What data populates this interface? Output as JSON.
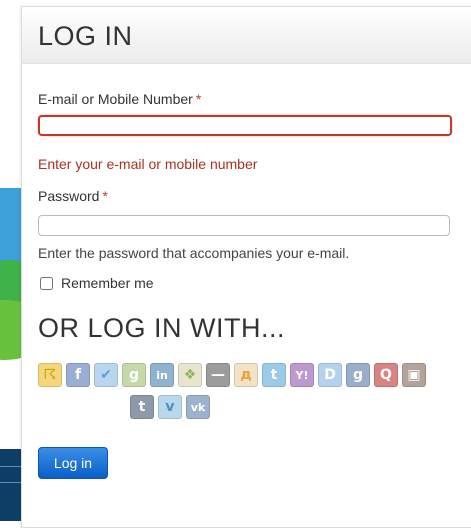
{
  "panel": {
    "title": "LOG IN"
  },
  "email": {
    "label": "E-mail or Mobile Number",
    "required_mark": "*",
    "value": "",
    "error": "Enter your e-mail or mobile number"
  },
  "password": {
    "label": "Password",
    "required_mark": "*",
    "value": "",
    "help": "Enter the password that accompanies your e-mail."
  },
  "remember": {
    "label": "Remember me",
    "checked": false
  },
  "social": {
    "title": "OR LOG IN WITH...",
    "providers_row1": [
      {
        "name": "AIM",
        "glyph": "☈",
        "color": "#f3d77a",
        "text_color": "#c99a00"
      },
      {
        "name": "Facebook",
        "glyph": "f",
        "color": "#9aaed3",
        "text_color": "#ffffff"
      },
      {
        "name": "Google (check)",
        "glyph": "✔",
        "color": "#b9d6ec",
        "text_color": "#5aa0d8"
      },
      {
        "name": "Google",
        "glyph": "g",
        "color": "#c6d9a9",
        "text_color": "#ffffff"
      },
      {
        "name": "LinkedIn",
        "glyph": "in",
        "color": "#8fb3cf",
        "text_color": "#ffffff"
      },
      {
        "name": "Windows Live",
        "glyph": "❖",
        "color": "#e8e4cf",
        "text_color": "#8cb85a"
      },
      {
        "name": "OpenID",
        "glyph": "—",
        "color": "#9c9c9c",
        "text_color": "#ffffff"
      },
      {
        "name": "Odnoklassniki",
        "glyph": "д",
        "color": "#f2e2c7",
        "text_color": "#f0a23a"
      },
      {
        "name": "Twitter",
        "glyph": "t",
        "color": "#9ccbe8",
        "text_color": "#ffffff"
      },
      {
        "name": "Yahoo",
        "glyph": "Y!",
        "color": "#bd99cd",
        "text_color": "#ffffff"
      },
      {
        "name": "Disqus",
        "glyph": "D",
        "color": "#b5d2ec",
        "text_color": "#ffffff"
      },
      {
        "name": "Google Plus",
        "glyph": "g",
        "color": "#98aeca",
        "text_color": "#ffffff"
      },
      {
        "name": "Quora",
        "glyph": "Q",
        "color": "#d98383",
        "text_color": "#ffffff"
      },
      {
        "name": "Instagram",
        "glyph": "▣",
        "color": "#b2a49a",
        "text_color": "#ffffff"
      }
    ],
    "providers_row2": [
      {
        "name": "Tumblr",
        "glyph": "t",
        "color": "#8d9aab",
        "text_color": "#ffffff"
      },
      {
        "name": "Vimeo",
        "glyph": "v",
        "color": "#b8d8ec",
        "text_color": "#4c8fc0"
      },
      {
        "name": "VK",
        "glyph": "vk",
        "color": "#9db2cc",
        "text_color": "#ffffff"
      }
    ]
  },
  "submit": {
    "label": "Log in"
  }
}
